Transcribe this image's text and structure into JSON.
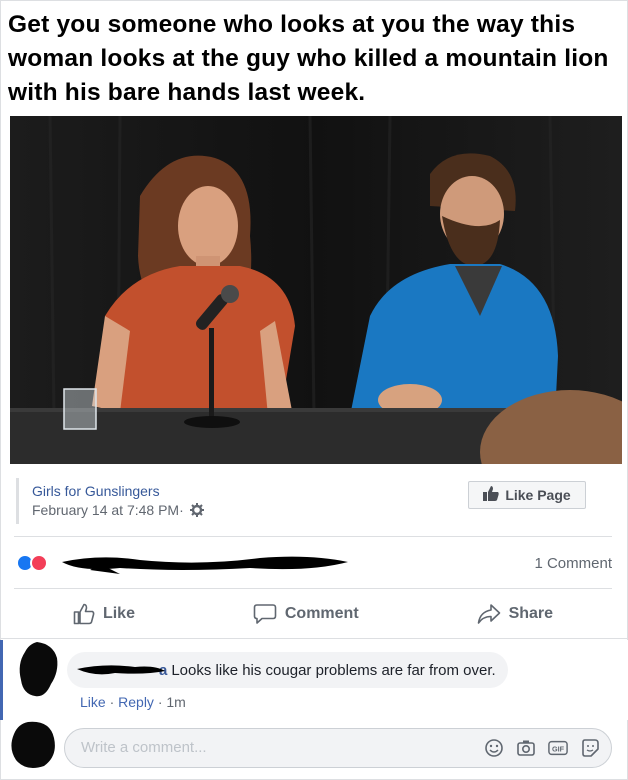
{
  "meme": {
    "title": "Get you someone who looks at you the way this woman looks at the guy who killed a mountain lion with his bare hands last week."
  },
  "post": {
    "page_name": "Girls for Gunslingers",
    "date": "February 14 at 7:48 PM",
    "separator": " · ",
    "like_page_label": "Like Page",
    "comment_count": "1 Comment"
  },
  "actions": {
    "like": "Like",
    "comment": "Comment",
    "share": "Share"
  },
  "comment": {
    "name_visible": "a",
    "text": "Looks like his cougar problems are far from over.",
    "like_label": "Like",
    "reply_label": "Reply",
    "time": "1m"
  },
  "compose": {
    "placeholder": "Write a comment..."
  },
  "colors": {
    "link_blue": "#365899",
    "fb_blue": "#4267b2",
    "like_reaction": "#1877f2",
    "love_reaction": "#f33e58",
    "shirt_orange": "#c2502d",
    "jacket_blue": "#1a78c2"
  },
  "icons": {
    "like": "thumbs-up-icon",
    "comment": "speech-bubble-icon",
    "share": "share-arrow-icon",
    "settings": "gear-icon",
    "emoji": "smiley-icon",
    "camera": "camera-icon",
    "gif": "gif-icon",
    "sticker": "sticker-icon"
  }
}
